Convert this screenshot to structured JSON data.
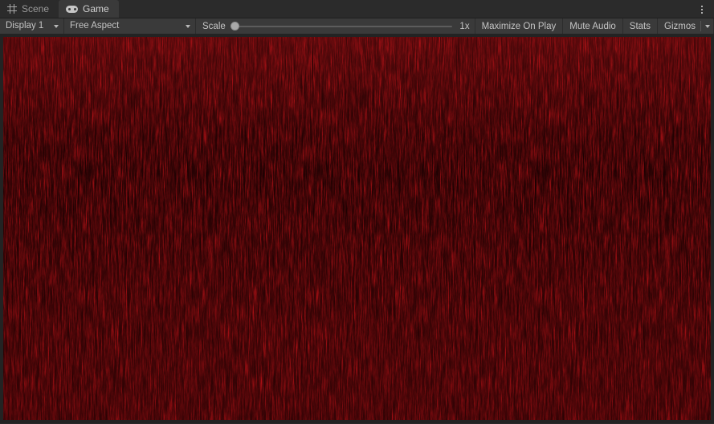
{
  "window": {
    "tabs": [
      {
        "label": "Scene",
        "icon": "grid-icon",
        "active": false
      },
      {
        "label": "Game",
        "icon": "gamepad-icon",
        "active": true
      }
    ],
    "menu_icon": "kebab-menu-icon"
  },
  "toolbar": {
    "display_label": "Display 1",
    "aspect_label": "Free Aspect",
    "scale_label": "Scale",
    "scale_value": "1x",
    "scale_slider_position_pct": 0,
    "maximize_on_play_label": "Maximize On Play",
    "mute_audio_label": "Mute Audio",
    "stats_label": "Stats",
    "gizmos_label": "Gizmos",
    "gizmos_dropdown_icon": "chevron-down-icon"
  },
  "gameview": {
    "content_description": "red-noise-fur-texture",
    "colors": {
      "base_red": "#d4141a",
      "highlight_red": "#f01c20",
      "shadow_red": "#8e0a10",
      "deep_shadow": "#5c060a",
      "viewport_border": "#232323"
    }
  },
  "theme": {
    "tabbar_bg": "#2b2b2b",
    "active_tab_bg": "#3a3a3a",
    "toolbar_bg": "#3a3a3a",
    "text": "#c4c4c4",
    "separator": "#2c2c2c"
  }
}
